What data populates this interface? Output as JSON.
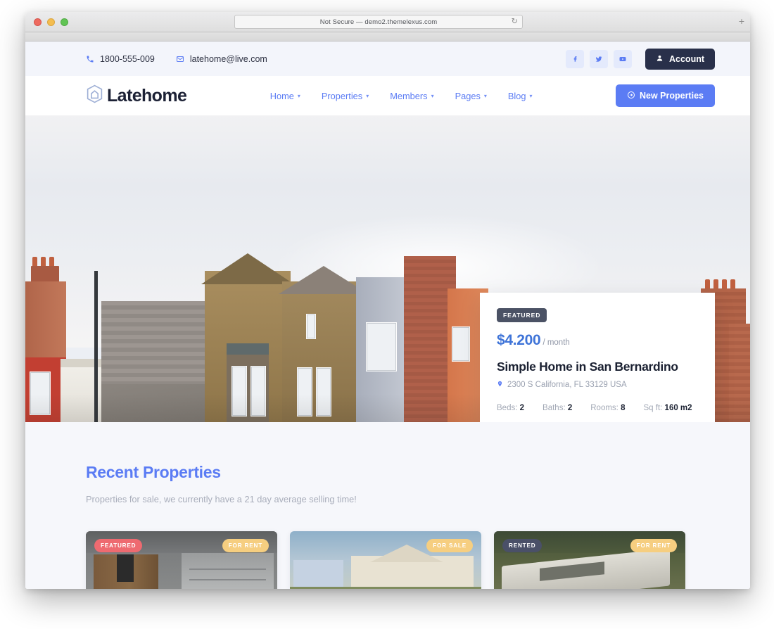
{
  "browser": {
    "url_text": "Not Secure — demo2.themelexus.com",
    "reload_glyph": "↻",
    "newtab_glyph": "+"
  },
  "topbar": {
    "phone": "1800-555-009",
    "email": "latehome@live.com",
    "social": [
      {
        "name": "facebook-icon",
        "glyph": "f"
      },
      {
        "name": "twitter-icon",
        "glyph": "t"
      },
      {
        "name": "youtube-icon",
        "glyph": "y"
      }
    ],
    "account_label": "Account"
  },
  "header": {
    "logo_text": "Latehome",
    "nav": [
      {
        "label": "Home",
        "caret": "▾"
      },
      {
        "label": "Properties",
        "caret": "▾"
      },
      {
        "label": "Members",
        "caret": "▾"
      },
      {
        "label": "Pages",
        "caret": "▾"
      },
      {
        "label": "Blog",
        "caret": "▾"
      }
    ],
    "cta_label": "New Properties"
  },
  "hero_card": {
    "badge": "FEATURED",
    "price": "$4.200",
    "price_unit": "/ month",
    "title": "Simple Home in San Bernardino",
    "address": "2300 S California, FL 33129 USA",
    "specs": [
      {
        "label": "Beds:",
        "value": "2"
      },
      {
        "label": "Baths:",
        "value": "2"
      },
      {
        "label": "Rooms:",
        "value": "8"
      },
      {
        "label": "Sq ft:",
        "value": "160 m2"
      }
    ]
  },
  "recent": {
    "title": "Recent Properties",
    "subtitle": "Properties for sale, we currently have a 21 day average selling time!",
    "cards": [
      {
        "name": "property-card-1",
        "badge_left": "FEATURED",
        "badge_right": "FOR RENT"
      },
      {
        "name": "property-card-2",
        "badge_left": "",
        "badge_right": "FOR SALE"
      },
      {
        "name": "property-card-3",
        "badge_left": "RENTED",
        "badge_right": "FOR RENT"
      }
    ]
  },
  "colors": {
    "accent_blue": "#5b7cf4",
    "dark_navy": "#29304a",
    "badge_red": "#ee6a70",
    "badge_amber": "#f6ce80",
    "page_bg": "#f6f7fb"
  }
}
